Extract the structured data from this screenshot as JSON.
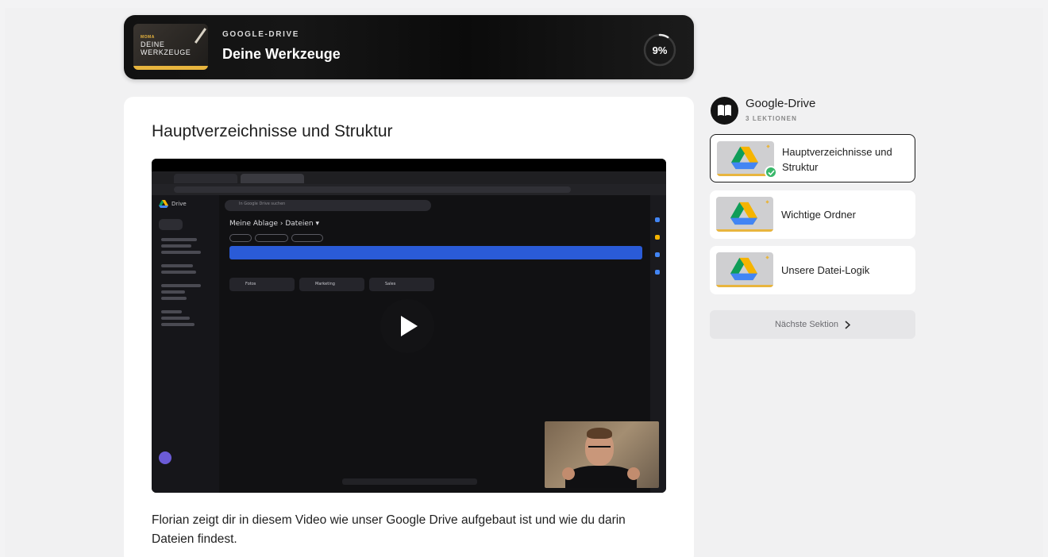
{
  "banner": {
    "thumb_kicker": "MOMA",
    "thumb_title": "DEINE WERKZEUGE",
    "kicker": "GOOGLE-DRIVE",
    "title": "Deine Werkzeuge",
    "progress_label": "9%",
    "progress_value": 0.09
  },
  "lesson": {
    "title": "Hauptverzeichnisse und Struktur",
    "description": "Florian zeigt dir in diesem Video wie unser Google Drive aufgebaut ist und wie du darin Dateien findest."
  },
  "video": {
    "app_name": "Drive",
    "search_placeholder": "In Google Drive suchen",
    "breadcrumb": "Meine Ablage  ›  Dateien ▾",
    "folders": [
      "Fotos",
      "Marketing",
      "Sales"
    ]
  },
  "sidebar": {
    "section_title": "Google-Drive",
    "section_subtitle": "3 LEKTIONEN",
    "lessons": [
      {
        "label": "Hauptverzeichnisse und Struktur",
        "active": true,
        "completed": true
      },
      {
        "label": "Wichtige Ordner",
        "active": false,
        "completed": false
      },
      {
        "label": "Unsere Datei-Logik",
        "active": false,
        "completed": false
      }
    ],
    "next_label": "Nächste Sektion"
  },
  "colors": {
    "accent_gold": "#e8b53e",
    "check_green": "#39b86a",
    "banner_bg": "#111111"
  }
}
